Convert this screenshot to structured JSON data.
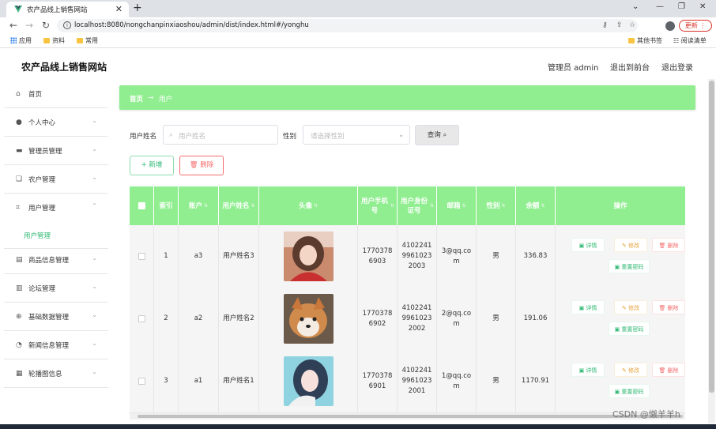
{
  "browser": {
    "tab_title": "农产品线上销售网站",
    "url": "localhost:8080/nongchanpinxiaoshou/admin/dist/index.html#/yonghu",
    "update_label": "更新",
    "bookmarks": [
      "应用",
      "资料",
      "常用"
    ],
    "bookmarks_right": [
      "其他书签",
      "阅读清单"
    ],
    "new_tab_glyph": "+",
    "close_glyph": "✕"
  },
  "header": {
    "site_title": "农产品线上销售网站",
    "admin_label": "管理员 admin",
    "back_front": "退出到前台",
    "logout": "退出登录"
  },
  "sidebar": {
    "items": [
      {
        "label": "首页",
        "icon": "home-icon"
      },
      {
        "label": "个人中心",
        "icon": "user-icon"
      },
      {
        "label": "管理员管理",
        "icon": "admin-icon"
      },
      {
        "label": "农户管理",
        "icon": "farmer-icon"
      },
      {
        "label": "用户管理",
        "icon": "crop-icon"
      },
      {
        "label": "商品信息管理",
        "icon": "goods-icon"
      },
      {
        "label": "论坛管理",
        "icon": "forum-icon"
      },
      {
        "label": "基础数据管理",
        "icon": "data-icon"
      },
      {
        "label": "新闻信息管理",
        "icon": "news-icon"
      },
      {
        "label": "轮播图信息",
        "icon": "carousel-icon"
      }
    ],
    "sub_item": "用户管理"
  },
  "breadcrumb": {
    "home": "首页",
    "arrow": "→",
    "current": "用户"
  },
  "filters": {
    "name_label": "用户姓名",
    "name_placeholder": "用户姓名",
    "gender_label": "性别",
    "gender_placeholder": "请选择性别",
    "query_label": "查询"
  },
  "actions": {
    "add_label": "新增",
    "delete_label": "删除"
  },
  "table": {
    "headers": {
      "index": "索引",
      "account": "账户",
      "name": "用户姓名",
      "avatar": "头像",
      "phone": "用户手机号",
      "idcard": "用户身份证号",
      "email": "邮箱",
      "gender": "性别",
      "balance": "余额",
      "ops": "操作"
    },
    "rows": [
      {
        "index": "1",
        "account": "a3",
        "name": "用户姓名3",
        "phone": "17703786903",
        "idcard": "410224199610232003",
        "email": "3@qq.com",
        "gender": "男",
        "balance": "336.83"
      },
      {
        "index": "2",
        "account": "a2",
        "name": "用户姓名2",
        "phone": "17703786902",
        "idcard": "410224199610232002",
        "email": "2@qq.com",
        "gender": "男",
        "balance": "191.06"
      },
      {
        "index": "3",
        "account": "a1",
        "name": "用户姓名1",
        "phone": "17703786901",
        "idcard": "410224199610232001",
        "email": "1@qq.com",
        "gender": "男",
        "balance": "1170.91"
      }
    ],
    "op_labels": {
      "detail": "详情",
      "edit": "修改",
      "delete": "删除",
      "reset": "重置密码"
    }
  },
  "watermark": "CSDN @懒羊羊h",
  "colors": {
    "accent_green": "#90ee90",
    "text_green": "#2eb873",
    "danger": "#f56c6c",
    "warning": "#e6a23c"
  }
}
